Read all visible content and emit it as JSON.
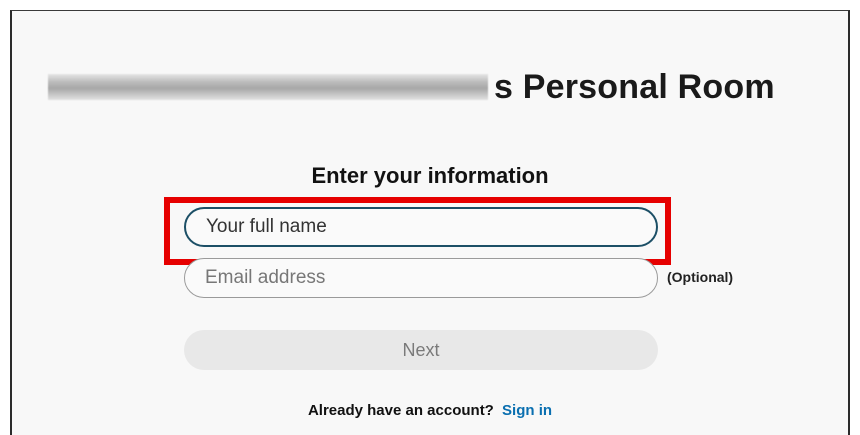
{
  "page": {
    "title_suffix": "s Personal Room",
    "heading": "Enter your information"
  },
  "form": {
    "name_placeholder": "Your full name",
    "email_placeholder": "Email address",
    "email_optional_label": "(Optional)",
    "next_label": "Next"
  },
  "footer": {
    "account_prompt": "Already have an account?",
    "signin_label": "Sign in"
  },
  "colors": {
    "highlight": "#e60000",
    "link": "#0a6fb0",
    "active_field_border": "#1c4f66"
  }
}
